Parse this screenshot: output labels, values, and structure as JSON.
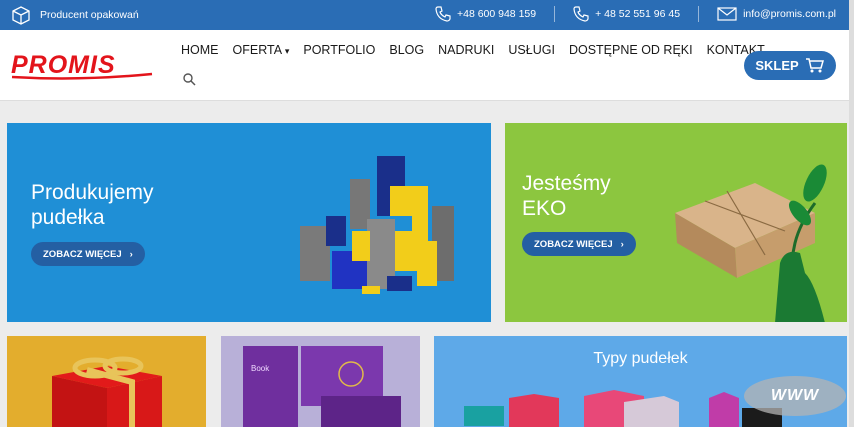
{
  "topbar": {
    "tagline": "Producent opakowań",
    "phone1": "+48 600 948 159",
    "phone2": "+ 48 52 551 96 45",
    "email": "info@promis.com.pl"
  },
  "brand": {
    "logo_text": "PROMIS",
    "logo_color": "#e3141b"
  },
  "nav": {
    "items": [
      "HOME",
      "OFERTA",
      "PORTFOLIO",
      "BLOG",
      "NADRUKI",
      "USŁUGI",
      "DOSTĘPNE OD RĘKI",
      "KONTAKT"
    ],
    "dropdown_marker": "▾"
  },
  "shop": {
    "label": "SKLEP"
  },
  "banners": [
    {
      "title_line1": "Produkujemy",
      "title_line2": "pudełka",
      "button": "ZOBACZ WIĘCEJ"
    },
    {
      "title_line1": "Jesteśmy",
      "title_line2": "EKO",
      "button": "ZOBACZ WIĘCEJ"
    }
  ],
  "tiles": {
    "types_title": "Typy pudełek",
    "book_text": "Book",
    "www_badge": "WWW"
  },
  "colors": {
    "topbar": "#2a6db5",
    "blue_banner": "#1f8fd6",
    "green_banner": "#8cc63f",
    "button": "#245fa3"
  }
}
